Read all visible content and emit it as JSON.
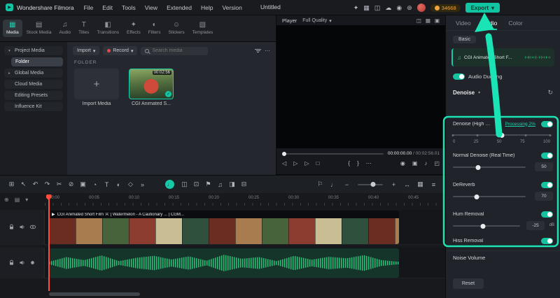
{
  "topbar": {
    "brand": "Wondershare Filmora",
    "menus": [
      "File",
      "Edit",
      "Tools",
      "View",
      "Extended",
      "Help",
      "Version"
    ],
    "project_title": "Untitled",
    "icons": [
      {
        "name": "gift-icon",
        "glyph": "✦"
      },
      {
        "name": "layout-icon",
        "glyph": "▦"
      },
      {
        "name": "screen-record-icon",
        "glyph": "◫"
      },
      {
        "name": "cloud-icon",
        "glyph": "☁"
      },
      {
        "name": "capture-icon",
        "glyph": "◉"
      },
      {
        "name": "plugin-icon",
        "glyph": "⊛"
      }
    ],
    "coins": "34668",
    "export": {
      "label": "Export",
      "caret": "▾"
    }
  },
  "media_tabs": [
    {
      "label": "Media",
      "glyph": "▦"
    },
    {
      "label": "Stock Media",
      "glyph": "▤"
    },
    {
      "label": "Audio",
      "glyph": "♫"
    },
    {
      "label": "Titles",
      "glyph": "T"
    },
    {
      "label": "Transitions",
      "glyph": "◧"
    },
    {
      "label": "Effects",
      "glyph": "✦"
    },
    {
      "label": "Filters",
      "glyph": "◐"
    },
    {
      "label": "Stickers",
      "glyph": "☺"
    },
    {
      "label": "Templates",
      "glyph": "▧"
    }
  ],
  "sidebar": [
    {
      "label": "Project Media",
      "chevron": "▾"
    },
    {
      "label": "Folder",
      "chevron": ""
    },
    {
      "label": "Global Media",
      "chevron": "▸"
    },
    {
      "label": "Cloud Media",
      "chevron": ""
    },
    {
      "label": "Editing Presets",
      "chevron": ""
    },
    {
      "label": "Influence Kit",
      "chevron": ""
    }
  ],
  "media_browser": {
    "import_button": "Import",
    "record_button": "Record",
    "caret": "▾",
    "search_placeholder": "Search media",
    "more": "⋯",
    "section": "FOLDER",
    "import_tile": {
      "plus": "+",
      "label": "Import Media"
    },
    "clip_tile": {
      "label": "CGI Animated S...",
      "duration": "00:02:56",
      "check": "✓"
    }
  },
  "player": {
    "title": "Player",
    "quality": "Full Quality",
    "caret": "▾",
    "header_icons": [
      {
        "name": "mini-screen-icon",
        "glyph": "◫"
      },
      {
        "name": "grid-icon",
        "glyph": "▦"
      },
      {
        "name": "frame-icon",
        "glyph": "▣"
      }
    ],
    "time_current": "00:00:00.00",
    "time_total": "/ 00:02:56.01",
    "transport": [
      {
        "name": "prev-frame-icon",
        "glyph": "◁"
      },
      {
        "name": "play-icon",
        "glyph": "▷"
      },
      {
        "name": "next-frame-icon",
        "glyph": "▷"
      },
      {
        "name": "stop-icon",
        "glyph": "□"
      }
    ],
    "marks": [
      {
        "name": "mark-in-icon",
        "glyph": "{"
      },
      {
        "name": "mark-out-icon",
        "glyph": "}"
      },
      {
        "name": "more-player-icon",
        "glyph": "⋯"
      }
    ],
    "view_icons": [
      {
        "name": "snapshot-icon",
        "glyph": "◉"
      },
      {
        "name": "crop-preview-icon",
        "glyph": "▣"
      },
      {
        "name": "volume-icon",
        "glyph": "♪"
      },
      {
        "name": "fullscreen-icon",
        "glyph": "◰"
      }
    ]
  },
  "audio_panel": {
    "tabs": [
      "Video",
      "Audio",
      "Color"
    ],
    "basic_badge": "Basic",
    "music_glyph": "♫",
    "clip_name": "CGI Animated Short F...",
    "audio_ducking": "Audio Ducking",
    "denoise_header": "Denoise",
    "caret": "▾",
    "reset_icon": "↻",
    "hq_denoise": {
      "label": "Denoise (High Qua...",
      "info": "ⓘ",
      "processing": "Processing 2%",
      "ticks": [
        "0",
        "25",
        "50",
        "75",
        "100"
      ]
    },
    "normal_denoise": {
      "label": "Normal Denoise (Real Time)",
      "value": "50"
    },
    "dereverb": {
      "label": "DeReverb",
      "value": "70"
    },
    "hum_removal": {
      "label": "Hum Removal",
      "value": "-25",
      "unit": "dB"
    },
    "hiss_removal": {
      "label": "Hiss Removal"
    },
    "noise_volume": "Noise Volume",
    "reset_button": "Reset"
  },
  "timeline": {
    "tools_left": [
      {
        "name": "phone-project-icon",
        "glyph": "⊞"
      },
      {
        "name": "select-tool-icon",
        "glyph": "↖"
      },
      {
        "name": "undo-icon",
        "glyph": "↶"
      },
      {
        "name": "redo-icon",
        "glyph": "↷"
      },
      {
        "name": "razor-icon",
        "glyph": "✂"
      },
      {
        "name": "delete-icon",
        "glyph": "⊘"
      },
      {
        "name": "crop-icon",
        "glyph": "▣"
      },
      {
        "name": "speed-icon",
        "glyph": "◔"
      },
      {
        "name": "text-tool-icon",
        "glyph": "T"
      },
      {
        "name": "mask-icon",
        "glyph": "◐"
      },
      {
        "name": "keyframe-icon",
        "glyph": "◇"
      },
      {
        "name": "more-tools-icon",
        "glyph": "»"
      }
    ],
    "voiceover_glyph": "♩",
    "tools_center": [
      {
        "name": "mixer-icon",
        "glyph": "◫"
      },
      {
        "name": "snapshot-timeline-icon",
        "glyph": "⊡"
      },
      {
        "name": "marker-icon",
        "glyph": "⚑"
      },
      {
        "name": "voice-effect-icon",
        "glyph": "♫"
      },
      {
        "name": "pip-icon",
        "glyph": "◨"
      },
      {
        "name": "split-icon",
        "glyph": "⊟"
      }
    ],
    "tools_right": [
      {
        "name": "flag-icon",
        "glyph": "⚐"
      },
      {
        "name": "mic-icon",
        "glyph": "♩"
      }
    ],
    "zoom": {
      "minus": "−",
      "plus": "+"
    },
    "tools_far_right": [
      {
        "name": "fit-timeline-icon",
        "glyph": "↔"
      },
      {
        "name": "track-manager-icon",
        "glyph": "▦"
      },
      {
        "name": "list-icon",
        "glyph": "≡"
      }
    ],
    "corner_tools": [
      {
        "name": "add-track-icon",
        "glyph": "⊕"
      },
      {
        "name": "track-menu-icon",
        "glyph": "▤"
      },
      {
        "name": "collapse-tracks-icon",
        "glyph": "▾"
      }
    ],
    "ruler": [
      "00:00",
      "00:05",
      "00:10",
      "00:15",
      "00:20",
      "00:25",
      "00:30",
      "00:35",
      "00:40",
      "00:45"
    ],
    "video_clip": {
      "play_glyph": "▶",
      "title": "CGI Animated Short Film 'A' | Watermelon - A Cautionary ... | CGM..."
    }
  }
}
